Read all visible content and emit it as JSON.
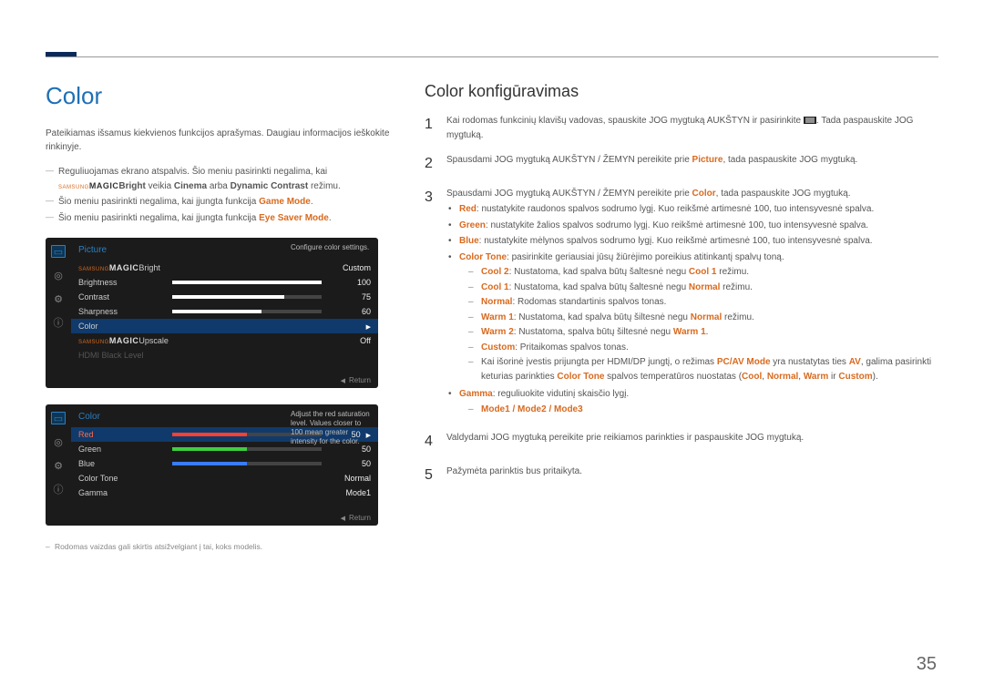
{
  "page_number": "35",
  "left": {
    "heading": "Color",
    "intro": "Pateikiamas išsamus kiekvienos funkcijos aprašymas. Daugiau informacijos ieškokite rinkinyje.",
    "note1_pre": "Reguliuojamas ekrano atspalvis. Šio meniu pasirinkti negalima, kai ",
    "note1_magic_label": "Bright",
    "note1_post1": " veikia ",
    "note1_cinema": "Cinema",
    "note1_or": " arba ",
    "note1_dc": "Dynamic Contrast",
    "note1_post2": " režimu.",
    "note2_pre": "Šio meniu pasirinkti negalima, kai įjungta funkcija ",
    "note2_strong": "Game Mode",
    "note3_pre": "Šio meniu pasirinkti negalima, kai įjungta funkcija ",
    "note3_strong": "Eye Saver Mode",
    "osd1": {
      "title": "Picture",
      "tip": "Configure color settings.",
      "rows": [
        {
          "label_magic": "Bright",
          "value": "Custom",
          "bar": null
        },
        {
          "label": "Brightness",
          "value": "100",
          "bar": 100
        },
        {
          "label": "Contrast",
          "value": "75",
          "bar": 75
        },
        {
          "label": "Sharpness",
          "value": "60",
          "bar": 60
        },
        {
          "label": "Color",
          "value": "",
          "bar": null,
          "selected": true
        },
        {
          "label_magic": "Upscale",
          "value": "Off",
          "bar": null
        },
        {
          "label": "HDMI Black Level",
          "value": "",
          "bar": null,
          "dim": true
        }
      ],
      "return": "Return"
    },
    "osd2": {
      "title": "Color",
      "tip": "Adjust the red saturation level. Values closer to 100 mean greater intensity for the color.",
      "rows": [
        {
          "label": "Red",
          "value": "50",
          "bar": 50,
          "color": "red",
          "selected": true
        },
        {
          "label": "Green",
          "value": "50",
          "bar": 50,
          "color": "green"
        },
        {
          "label": "Blue",
          "value": "50",
          "bar": 50,
          "color": "blue"
        },
        {
          "label": "Color Tone",
          "value": "Normal",
          "bar": null
        },
        {
          "label": "Gamma",
          "value": "Mode1",
          "bar": null
        }
      ],
      "return": "Return"
    },
    "footnote": "Rodomas vaizdas gali skirtis atsižvelgiant į tai, koks modelis."
  },
  "right": {
    "heading": "Color konfigūravimas",
    "step1_a": "Kai rodomas funkcinių klavišų vadovas, spauskite JOG mygtuką AUKŠTYN ir pasirinkite ",
    "step1_b": ". Tada paspauskite JOG mygtuką.",
    "step2_a": "Spausdami JOG mygtuką AUKŠTYN / ŽEMYN pereikite prie ",
    "step2_picture": "Picture",
    "step2_b": ", tada paspauskite JOG mygtuką.",
    "step3_a": "Spausdami JOG mygtuką AUKŠTYN / ŽEMYN pereikite prie ",
    "step3_color": "Color",
    "step3_b": ", tada paspauskite JOG mygtuką.",
    "b_red_label": "Red",
    "b_red_text": ": nustatykite raudonos spalvos sodrumo lygį. Kuo reikšmė artimesnė 100, tuo intensyvesnė spalva.",
    "b_green_label": "Green",
    "b_green_text": ": nustatykite žalios spalvos sodrumo lygį. Kuo reikšmė artimesnė 100, tuo intensyvesnė spalva.",
    "b_blue_label": "Blue",
    "b_blue_text": ": nustatykite mėlynos spalvos sodrumo lygį. Kuo reikšmė artimesnė 100, tuo intensyvesnė spalva.",
    "b_ct_label": "Color Tone",
    "b_ct_text": ": pasirinkite geriausiai jūsų žiūrėjimo poreikius atitinkantį spalvų toną.",
    "ct_cool2_l": "Cool 2",
    "ct_cool2_t": ": Nustatoma, kad spalva būtų šaltesnė negu ",
    "ct_cool2_s": "Cool 1",
    "ct_cool2_e": " režimu.",
    "ct_cool1_l": "Cool 1",
    "ct_cool1_t": ": Nustatoma, kad spalva būtų šaltesnė negu ",
    "ct_cool1_s": "Normal",
    "ct_cool1_e": " režimu.",
    "ct_norm_l": "Normal",
    "ct_norm_t": ": Rodomas standartinis spalvos tonas.",
    "ct_warm1_l": "Warm 1",
    "ct_warm1_t": ": Nustatoma, kad spalva būtų šiltesnė negu ",
    "ct_warm1_s": "Normal",
    "ct_warm1_e": " režimu.",
    "ct_warm2_l": "Warm 2",
    "ct_warm2_t": ": Nustatoma, spalva būtų šiltesnė negu ",
    "ct_warm2_s": "Warm 1",
    "ct_warm2_e": ".",
    "ct_cust_l": "Custom",
    "ct_cust_t": ": Pritaikomas spalvos tonas.",
    "ct_note_a": "Kai išorinė įvestis prijungta per HDMI/DP jungtį, o režimas ",
    "ct_note_pcav": "PC/AV Mode",
    "ct_note_b": " yra nustatytas ties ",
    "ct_note_av": "AV",
    "ct_note_c": ", galima pasirinkti keturias parinkties ",
    "ct_note_ct": "Color Tone",
    "ct_note_d": " spalvos temperatūros nuostatas (",
    "ct_note_cool": "Cool",
    "ct_note_sep1": ", ",
    "ct_note_norm": "Normal",
    "ct_note_sep2": ", ",
    "ct_note_warm": "Warm",
    "ct_note_or": " ir ",
    "ct_note_custom": "Custom",
    "ct_note_end": ").",
    "b_gamma_l": "Gamma",
    "b_gamma_t": ": reguliuokite vidutinį skaisčio lygį.",
    "gamma_modes": "Mode1 / Mode2 / Mode3",
    "step4": "Valdydami JOG mygtuką pereikite prie reikiamos parinkties ir paspauskite JOG mygtuką.",
    "step5": "Pažymėta parinktis bus pritaikyta."
  }
}
